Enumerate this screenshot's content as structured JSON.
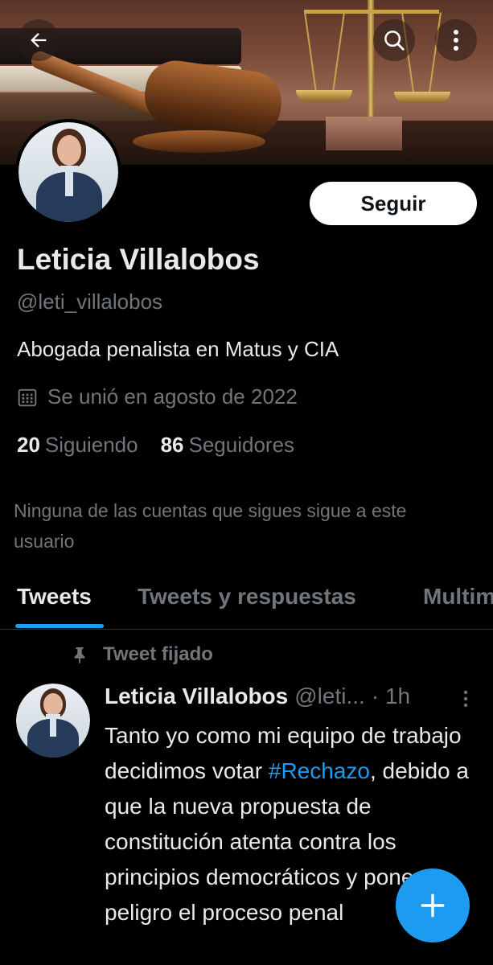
{
  "header": {
    "back_icon": "arrow-left-icon",
    "search_icon": "search-icon",
    "more_icon": "more-vertical-icon"
  },
  "profile": {
    "name": "Leticia Villalobos",
    "handle": "@leti_villalobos",
    "bio": "Abogada penalista en Matus y CIA",
    "joined": "Se unió en agosto de 2022",
    "following_count": "20",
    "following_label": "Siguiendo",
    "followers_count": "86",
    "followers_label": "Seguidores",
    "follow_button": "Seguir",
    "notice": "Ninguna de las cuentas que sigues sigue a este usuario"
  },
  "tabs": [
    {
      "label": "Tweets",
      "active": true
    },
    {
      "label": "Tweets y respuestas",
      "active": false
    },
    {
      "label": "Multim",
      "active": false
    }
  ],
  "tweet": {
    "pinned_label": "Tweet fijado",
    "author_name": "Leticia Villalobos",
    "author_handle": "@leti...",
    "time": "· 1h",
    "text_before": "Tanto yo como mi equipo de trabajo decidimos votar ",
    "hashtag": "#Rechazo",
    "text_after": ", debido a que la nueva propuesta de constitución atenta contra los principios democráticos y pone en peligro el proceso penal"
  },
  "colors": {
    "accent": "#1d9bf0",
    "background": "#000000",
    "secondary_text": "#71767b"
  },
  "fab_icon": "plus-icon"
}
